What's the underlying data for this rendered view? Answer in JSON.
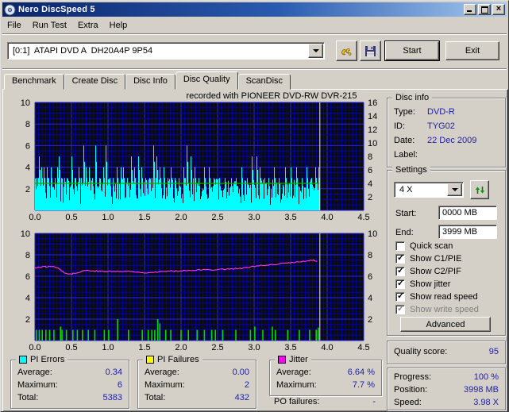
{
  "window": {
    "title": "Nero DiscSpeed 5"
  },
  "menu": {
    "items": [
      "File",
      "Run Test",
      "Extra",
      "Help"
    ]
  },
  "toolbar": {
    "drive_selector": "[0:1]  ATAPI DVD A  DH20A4P 9P54",
    "start_label": "Start",
    "exit_label": "Exit"
  },
  "tabs": {
    "items": [
      "Benchmark",
      "Create Disc",
      "Disc Info",
      "Disc Quality",
      "ScanDisc"
    ],
    "active": "Disc Quality"
  },
  "disc_info": {
    "title": "Disc info",
    "rows": [
      {
        "label": "Type:",
        "value": "DVD-R"
      },
      {
        "label": "ID:",
        "value": "TYG02"
      },
      {
        "label": "Date:",
        "value": "22 Dec 2009"
      },
      {
        "label": "Label:",
        "value": ""
      }
    ]
  },
  "settings": {
    "title": "Settings",
    "speed_value": "4 X",
    "start_label": "Start:",
    "start_value": "0000 MB",
    "end_label": "End:",
    "end_value": "3999 MB",
    "checkboxes": [
      {
        "label": "Quick scan",
        "checked": false,
        "disabled": false
      },
      {
        "label": "Show C1/PIE",
        "checked": true,
        "disabled": false
      },
      {
        "label": "Show C2/PIF",
        "checked": true,
        "disabled": false
      },
      {
        "label": "Show jitter",
        "checked": true,
        "disabled": false
      },
      {
        "label": "Show read speed",
        "checked": true,
        "disabled": false
      },
      {
        "label": "Show write speed",
        "checked": true,
        "disabled": true
      }
    ],
    "advanced_label": "Advanced"
  },
  "quality": {
    "label": "Quality score:",
    "value": "95"
  },
  "progress": {
    "rows": [
      {
        "label": "Progress:",
        "value": "100 %"
      },
      {
        "label": "Position:",
        "value": "3998 MB"
      },
      {
        "label": "Speed:",
        "value": "3.98 X"
      }
    ]
  },
  "stats": {
    "pi_errors": {
      "title": "PI Errors",
      "swatch_color": "#00ffff",
      "rows": [
        {
          "label": "Average:",
          "value": "0.34"
        },
        {
          "label": "Maximum:",
          "value": "6"
        },
        {
          "label": "Total:",
          "value": "5383"
        }
      ]
    },
    "pi_failures": {
      "title": "PI Failures",
      "swatch_color": "#ffff00",
      "rows": [
        {
          "label": "Average:",
          "value": "0.00"
        },
        {
          "label": "Maximum:",
          "value": "2"
        },
        {
          "label": "Total:",
          "value": "432"
        }
      ]
    },
    "jitter": {
      "title": "Jitter",
      "swatch_color": "#ff00ff",
      "rows": [
        {
          "label": "Average:",
          "value": "6.64 %"
        },
        {
          "label": "Maximum:",
          "value": "7.7 %"
        }
      ]
    },
    "po_failures": {
      "label": "PO failures:",
      "value": "-"
    }
  },
  "colors": {
    "value_text": "#2020a8",
    "chart_bg": "#0b0b0b",
    "grid_minor": "#0000ae",
    "grid_major": "#2424e8",
    "cursor": "#ededed",
    "titlebar_left": "#0a246a",
    "titlebar_right": "#a6caf0"
  },
  "chart_data": [
    {
      "type": "area",
      "title": "recorded with PIONEER  DVD-RW  DVR-215",
      "series_name": "PI Errors",
      "x_min": 0,
      "x_max": 4.5,
      "x_tick_step": 0.5,
      "x_ticks": [
        "0.0",
        "0.5",
        "1.0",
        "1.5",
        "2.0",
        "2.5",
        "3.0",
        "3.5",
        "4.0",
        "4.5"
      ],
      "y_left_min": 0,
      "y_left_max": 10,
      "y_left_ticks": [
        2,
        4,
        6,
        8,
        10
      ],
      "y_right_max": 16,
      "y_right_ticks": [
        2,
        4,
        6,
        8,
        10,
        12,
        14,
        16
      ],
      "grid": {
        "minor_x": 0.05,
        "major_x": 0.5,
        "minor_y": 0.5,
        "major_y": 2
      },
      "data_end_x": 3.9,
      "cursor_x": 3.9,
      "base": {
        "level": 2.0,
        "variation": 1.0,
        "dip_chance": 0.12,
        "seed": 12345
      },
      "spikes": [
        [
          0.02,
          3
        ],
        [
          0.05,
          5
        ],
        [
          0.09,
          4
        ],
        [
          0.12,
          4
        ],
        [
          0.16,
          4
        ],
        [
          0.19,
          3
        ],
        [
          0.22,
          4
        ],
        [
          0.27,
          3
        ],
        [
          0.3,
          4
        ],
        [
          0.33,
          5
        ],
        [
          0.36,
          3
        ],
        [
          0.4,
          3
        ],
        [
          0.44,
          3
        ],
        [
          0.5,
          5
        ],
        [
          0.55,
          3
        ],
        [
          0.6,
          4
        ],
        [
          0.63,
          3
        ],
        [
          0.66,
          6
        ],
        [
          0.7,
          4
        ],
        [
          0.74,
          4
        ],
        [
          0.78,
          3
        ],
        [
          0.83,
          6
        ],
        [
          0.88,
          3
        ],
        [
          0.93,
          4
        ],
        [
          0.97,
          6
        ],
        [
          1.02,
          3
        ],
        [
          1.07,
          3
        ],
        [
          1.12,
          4
        ],
        [
          1.17,
          4
        ],
        [
          1.21,
          4
        ],
        [
          1.26,
          3
        ],
        [
          1.31,
          5
        ],
        [
          1.36,
          4
        ],
        [
          1.41,
          5
        ],
        [
          1.46,
          4
        ],
        [
          1.51,
          3
        ],
        [
          1.56,
          3
        ],
        [
          1.62,
          6
        ],
        [
          1.66,
          5
        ],
        [
          1.71,
          4
        ],
        [
          1.76,
          4
        ],
        [
          1.81,
          3
        ],
        [
          1.86,
          4
        ],
        [
          1.91,
          3
        ],
        [
          1.97,
          3
        ],
        [
          2.03,
          4
        ],
        [
          2.08,
          6
        ],
        [
          2.13,
          5
        ],
        [
          2.18,
          4
        ],
        [
          2.24,
          3
        ],
        [
          2.31,
          4
        ],
        [
          2.38,
          4
        ],
        [
          2.45,
          3
        ],
        [
          2.52,
          3
        ],
        [
          2.6,
          3
        ],
        [
          2.68,
          3
        ],
        [
          2.75,
          3
        ],
        [
          2.83,
          4
        ],
        [
          2.9,
          3
        ],
        [
          2.97,
          5
        ],
        [
          3.03,
          5
        ],
        [
          3.08,
          4
        ],
        [
          3.14,
          3
        ],
        [
          3.2,
          3
        ],
        [
          3.27,
          4
        ],
        [
          3.34,
          3
        ],
        [
          3.42,
          4
        ],
        [
          3.5,
          4
        ],
        [
          3.58,
          4
        ],
        [
          3.65,
          3
        ],
        [
          3.72,
          4
        ],
        [
          3.78,
          3
        ],
        [
          3.84,
          4
        ],
        [
          3.88,
          4
        ]
      ],
      "speed_line": {
        "right_value": 4.0
      },
      "colors": {
        "bars": "#00ffff",
        "speed": "#00b400"
      }
    },
    {
      "type": "line+spikes",
      "series_name": "Jitter and PI Failures",
      "x_min": 0,
      "x_max": 4.5,
      "x_tick_step": 0.5,
      "x_ticks": [
        "0.0",
        "0.5",
        "1.0",
        "1.5",
        "2.0",
        "2.5",
        "3.0",
        "3.5",
        "4.0",
        "4.5"
      ],
      "y_left_min": 0,
      "y_left_max": 10,
      "y_left_ticks": [
        2,
        4,
        6,
        8,
        10
      ],
      "y_right_max": 10,
      "y_right_ticks": [
        2,
        4,
        6,
        8,
        10
      ],
      "grid": {
        "minor_x": 0.05,
        "major_x": 0.5,
        "minor_y": 0.5,
        "major_y": 2
      },
      "data_end_x": 3.9,
      "cursor_x": 3.9,
      "line_noise": 0.12,
      "line_seed": 77,
      "line_points": [
        [
          0,
          6.8
        ],
        [
          0.08,
          6.85
        ],
        [
          0.15,
          6.9
        ],
        [
          0.25,
          6.9
        ],
        [
          0.32,
          6.8
        ],
        [
          0.38,
          6.4
        ],
        [
          0.45,
          6.25
        ],
        [
          0.52,
          6.25
        ],
        [
          0.58,
          6.3
        ],
        [
          0.65,
          6.5
        ],
        [
          0.72,
          6.55
        ],
        [
          0.8,
          6.5
        ],
        [
          0.9,
          6.45
        ],
        [
          1.0,
          6.45
        ],
        [
          1.15,
          6.45
        ],
        [
          1.3,
          6.45
        ],
        [
          1.45,
          6.35
        ],
        [
          1.55,
          6.35
        ],
        [
          1.65,
          6.4
        ],
        [
          1.8,
          6.45
        ],
        [
          1.95,
          6.5
        ],
        [
          2.1,
          6.55
        ],
        [
          2.25,
          6.6
        ],
        [
          2.4,
          6.6
        ],
        [
          2.55,
          6.65
        ],
        [
          2.7,
          6.7
        ],
        [
          2.85,
          6.75
        ],
        [
          2.95,
          6.85
        ],
        [
          3.05,
          7.0
        ],
        [
          3.15,
          7.0
        ],
        [
          3.25,
          7.05
        ],
        [
          3.35,
          7.15
        ],
        [
          3.45,
          7.25
        ],
        [
          3.55,
          7.3
        ],
        [
          3.65,
          7.35
        ],
        [
          3.75,
          7.45
        ],
        [
          3.82,
          7.5
        ],
        [
          3.88,
          7.4
        ]
      ],
      "failure_spikes": [
        [
          0.02,
          1
        ],
        [
          0.06,
          1
        ],
        [
          0.1,
          1
        ],
        [
          0.15,
          1
        ],
        [
          0.2,
          1
        ],
        [
          0.26,
          1
        ],
        [
          0.35,
          1.3
        ],
        [
          0.37,
          1
        ],
        [
          0.43,
          1
        ],
        [
          0.52,
          1
        ],
        [
          0.58,
          1
        ],
        [
          0.65,
          1
        ],
        [
          0.73,
          1
        ],
        [
          0.82,
          1
        ],
        [
          0.95,
          1
        ],
        [
          1.01,
          1
        ],
        [
          1.13,
          2
        ],
        [
          1.28,
          1
        ],
        [
          1.47,
          1
        ],
        [
          1.55,
          1
        ],
        [
          1.6,
          1
        ],
        [
          1.64,
          1
        ],
        [
          1.68,
          2
        ],
        [
          1.71,
          1.6
        ],
        [
          1.79,
          1
        ],
        [
          1.86,
          1
        ],
        [
          2.0,
          1
        ],
        [
          2.1,
          1
        ],
        [
          2.22,
          1
        ],
        [
          2.32,
          1
        ],
        [
          2.42,
          1
        ],
        [
          2.47,
          1
        ],
        [
          2.57,
          1
        ],
        [
          2.75,
          1
        ],
        [
          2.95,
          1
        ],
        [
          3.01,
          1.3
        ],
        [
          3.12,
          1
        ],
        [
          3.25,
          1.3
        ],
        [
          3.29,
          1
        ],
        [
          3.46,
          1
        ],
        [
          3.62,
          1
        ],
        [
          3.76,
          1
        ],
        [
          3.85,
          1
        ],
        [
          3.88,
          1.2
        ]
      ],
      "colors": {
        "line": "#ff38d8",
        "failures": "#00dc00"
      }
    }
  ]
}
